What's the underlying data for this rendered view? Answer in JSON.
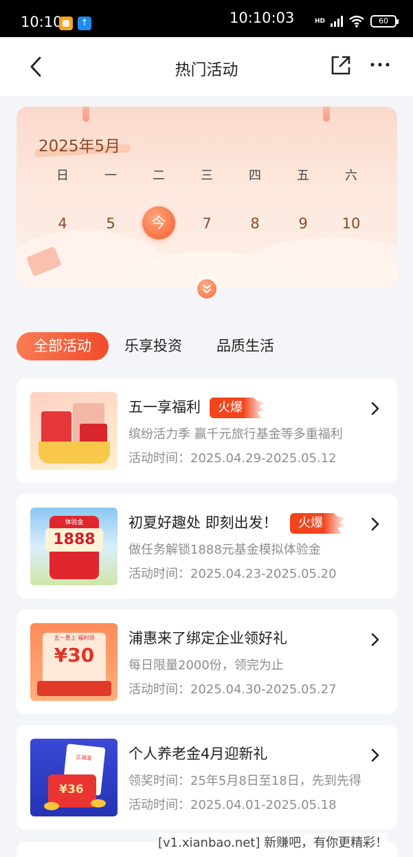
{
  "status_bar": {
    "time_left": "10:10",
    "time_center": "10:10:03",
    "network": "HD",
    "battery": "60"
  },
  "nav": {
    "title": "热门活动"
  },
  "calendar": {
    "month": "2025年5月",
    "weekdays": [
      "日",
      "一",
      "二",
      "三",
      "四",
      "五",
      "六"
    ],
    "days": [
      "4",
      "5",
      "今",
      "7",
      "8",
      "9",
      "10"
    ],
    "today_label": "今"
  },
  "tabs": [
    {
      "label": "全部活动",
      "active": true
    },
    {
      "label": "乐享投资",
      "active": false
    },
    {
      "label": "品质生活",
      "active": false
    }
  ],
  "activities": [
    {
      "title": "五一享福利",
      "badge": "火爆",
      "desc": "缤纷活力季 赢千元旅行基金等多重福利",
      "time_label": "活动时间：",
      "time": "2025.04.29-2025.05.12"
    },
    {
      "title": "初夏好趣处 即刻出发！",
      "badge": "火爆",
      "desc": "做任务解锁1888元基金模拟体验金",
      "time_label": "活动时间：",
      "time": "2025.04.23-2025.05.20",
      "thumb_label_top": "体验金",
      "thumb_amount": "1888"
    },
    {
      "title": "浦惠来了绑定企业领好礼",
      "badge": "",
      "desc": "每日限量2000份，领完为止",
      "time_label": "活动时间：",
      "time": "2025.04.30-2025.05.27",
      "thumb_label_top": "五一惠上 福利领",
      "thumb_amount": "¥30"
    },
    {
      "title": "个人养老金4月迎新礼",
      "badge": "",
      "desc": "领奖时间：25年5月8日至18日，先到先得",
      "time_label": "活动时间：",
      "time": "2025.04.01-2025.05.18",
      "thumb_label_top": "立减金",
      "thumb_amount": "¥36"
    }
  ],
  "watermark": "[v1.xianbao.net] 新赚吧，有你更精彩！",
  "colors": {
    "accent": "#f04c2a",
    "hot_badge": "#f2451d",
    "text_secondary": "#8d8d8d"
  },
  "icons": {
    "back": "chevron-left-icon",
    "share": "share-icon",
    "more": "more-icon",
    "expand": "double-chevron-down-icon",
    "card_arrow": "chevron-right-icon"
  }
}
